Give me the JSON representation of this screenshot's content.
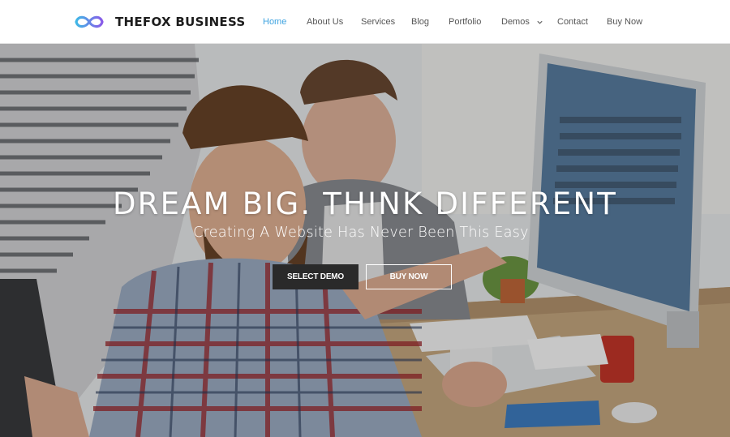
{
  "brand": {
    "name": "THEFOX BUSINESS",
    "logo_icon": "infinity-logo-icon"
  },
  "nav": {
    "items": [
      {
        "label": "Home",
        "active": true
      },
      {
        "label": "About Us"
      },
      {
        "label": "Services"
      },
      {
        "label": "Blog"
      },
      {
        "label": "Portfolio"
      },
      {
        "label": "Demos",
        "icon": "chevron-down-icon"
      },
      {
        "label": "Contact"
      },
      {
        "label": "Buy Now"
      }
    ]
  },
  "hero": {
    "headline": "DREAM BIG. THINK DIFFERENT",
    "subheadline": "Creating A Website Has Never Been This Easy",
    "buttons": {
      "select_demo": "SELECT DEMO",
      "buy_now": "BUY NOW"
    }
  },
  "colors": {
    "accent": "#3ea3e0",
    "dark_button": "#2a2a2a",
    "logo_gradient_start": "#3fb7e6",
    "logo_gradient_end": "#8a5be8"
  }
}
